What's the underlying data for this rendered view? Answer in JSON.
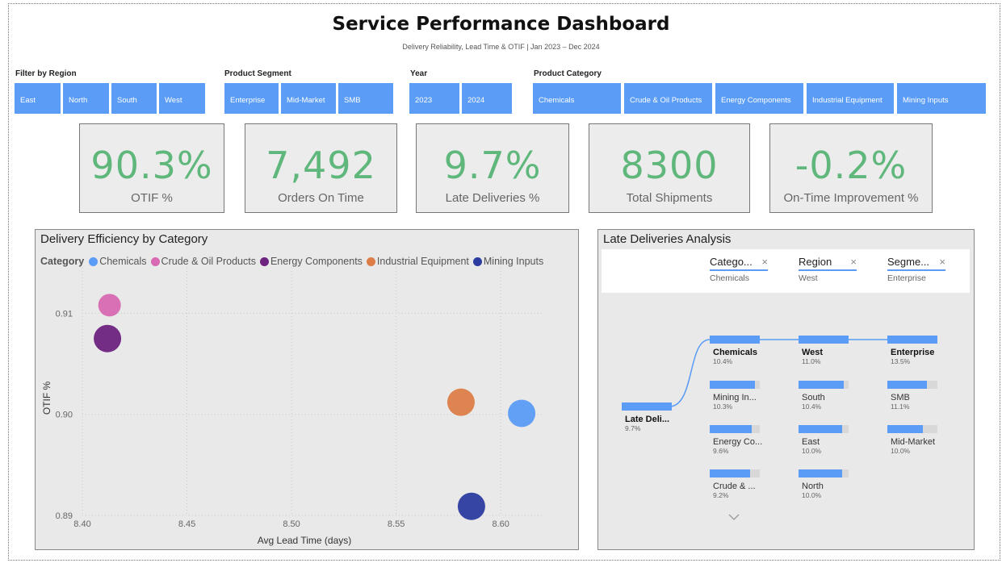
{
  "header": {
    "title": "Service Performance Dashboard",
    "subtitle": "Delivery Reliability, Lead Time & OTIF | Jan 2023 – Dec 2024"
  },
  "filters": {
    "region": {
      "label": "Filter by Region",
      "options": [
        "East",
        "North",
        "South",
        "West"
      ]
    },
    "segment": {
      "label": "Product Segment",
      "options": [
        "Enterprise",
        "Mid-Market",
        "SMB"
      ]
    },
    "year": {
      "label": "Year",
      "options": [
        "2023",
        "2024"
      ]
    },
    "category": {
      "label": "Product Category",
      "options": [
        "Chemicals",
        "Crude & Oil Products",
        "Energy Components",
        "Industrial Equipment",
        "Mining Inputs"
      ]
    }
  },
  "kpis": [
    {
      "value": "90.3%",
      "label": "OTIF %"
    },
    {
      "value": "7,492",
      "label": "Orders On Time"
    },
    {
      "value": "9.7%",
      "label": "Late Deliveries %"
    },
    {
      "value": "8300",
      "label": "Total Shipments"
    },
    {
      "value": "-0.2%",
      "label": "On-Time Improvement %"
    }
  ],
  "scatter_panel": {
    "title": "Delivery Efficiency by Category",
    "legend_title": "Category"
  },
  "chart_data": {
    "type": "scatter",
    "title": "Delivery Efficiency by Category",
    "xlabel": "Avg Lead Time (days)",
    "ylabel": "OTIF %",
    "xlim": [
      8.4,
      8.62
    ],
    "ylim": [
      0.89,
      0.9145
    ],
    "xticks": [
      "8.40",
      "8.45",
      "8.50",
      "8.55",
      "8.60"
    ],
    "yticks": [
      "0.89",
      "0.90",
      "0.91"
    ],
    "grid": true,
    "legend_position": "top",
    "series": [
      {
        "name": "Chemicals",
        "color": "#5b9cf6",
        "x": 8.61,
        "y": 0.9001
      },
      {
        "name": "Crude & Oil Products",
        "color": "#d869b3",
        "x": 8.413,
        "y": 0.9108
      },
      {
        "name": "Energy Components",
        "color": "#6d2380",
        "x": 8.412,
        "y": 0.9075
      },
      {
        "name": "Industrial Equipment",
        "color": "#dd7e49",
        "x": 8.581,
        "y": 0.9012
      },
      {
        "name": "Mining Inputs",
        "color": "#2c3ca0",
        "x": 8.586,
        "y": 0.8909
      }
    ]
  },
  "tree_panel": {
    "title": "Late Deliveries Analysis",
    "crumbs": [
      {
        "name": "Catego...",
        "value": "Chemicals"
      },
      {
        "name": "Region",
        "value": "West"
      },
      {
        "name": "Segme...",
        "value": "Enterprise"
      }
    ],
    "root": {
      "label": "Late Deli...",
      "value": "9.7%",
      "pct": 9.7
    },
    "levels": [
      [
        {
          "label": "Chemicals",
          "value": "10.4%",
          "pct": 10.4,
          "selected": true
        },
        {
          "label": "Mining In...",
          "value": "10.3%",
          "pct": 10.3
        },
        {
          "label": "Energy Co...",
          "value": "9.6%",
          "pct": 9.6
        },
        {
          "label": "Crude & ...",
          "value": "9.2%",
          "pct": 9.2
        }
      ],
      [
        {
          "label": "West",
          "value": "11.0%",
          "pct": 11.0,
          "selected": true
        },
        {
          "label": "South",
          "value": "10.4%",
          "pct": 10.4
        },
        {
          "label": "East",
          "value": "10.0%",
          "pct": 10.0
        },
        {
          "label": "North",
          "value": "10.0%",
          "pct": 10.0
        }
      ],
      [
        {
          "label": "Enterprise",
          "value": "13.5%",
          "pct": 13.5,
          "selected": true
        },
        {
          "label": "SMB",
          "value": "11.1%",
          "pct": 11.1
        },
        {
          "label": "Mid-Market",
          "value": "10.0%",
          "pct": 10.0
        }
      ]
    ],
    "more_icon": "chevron-down-icon"
  }
}
